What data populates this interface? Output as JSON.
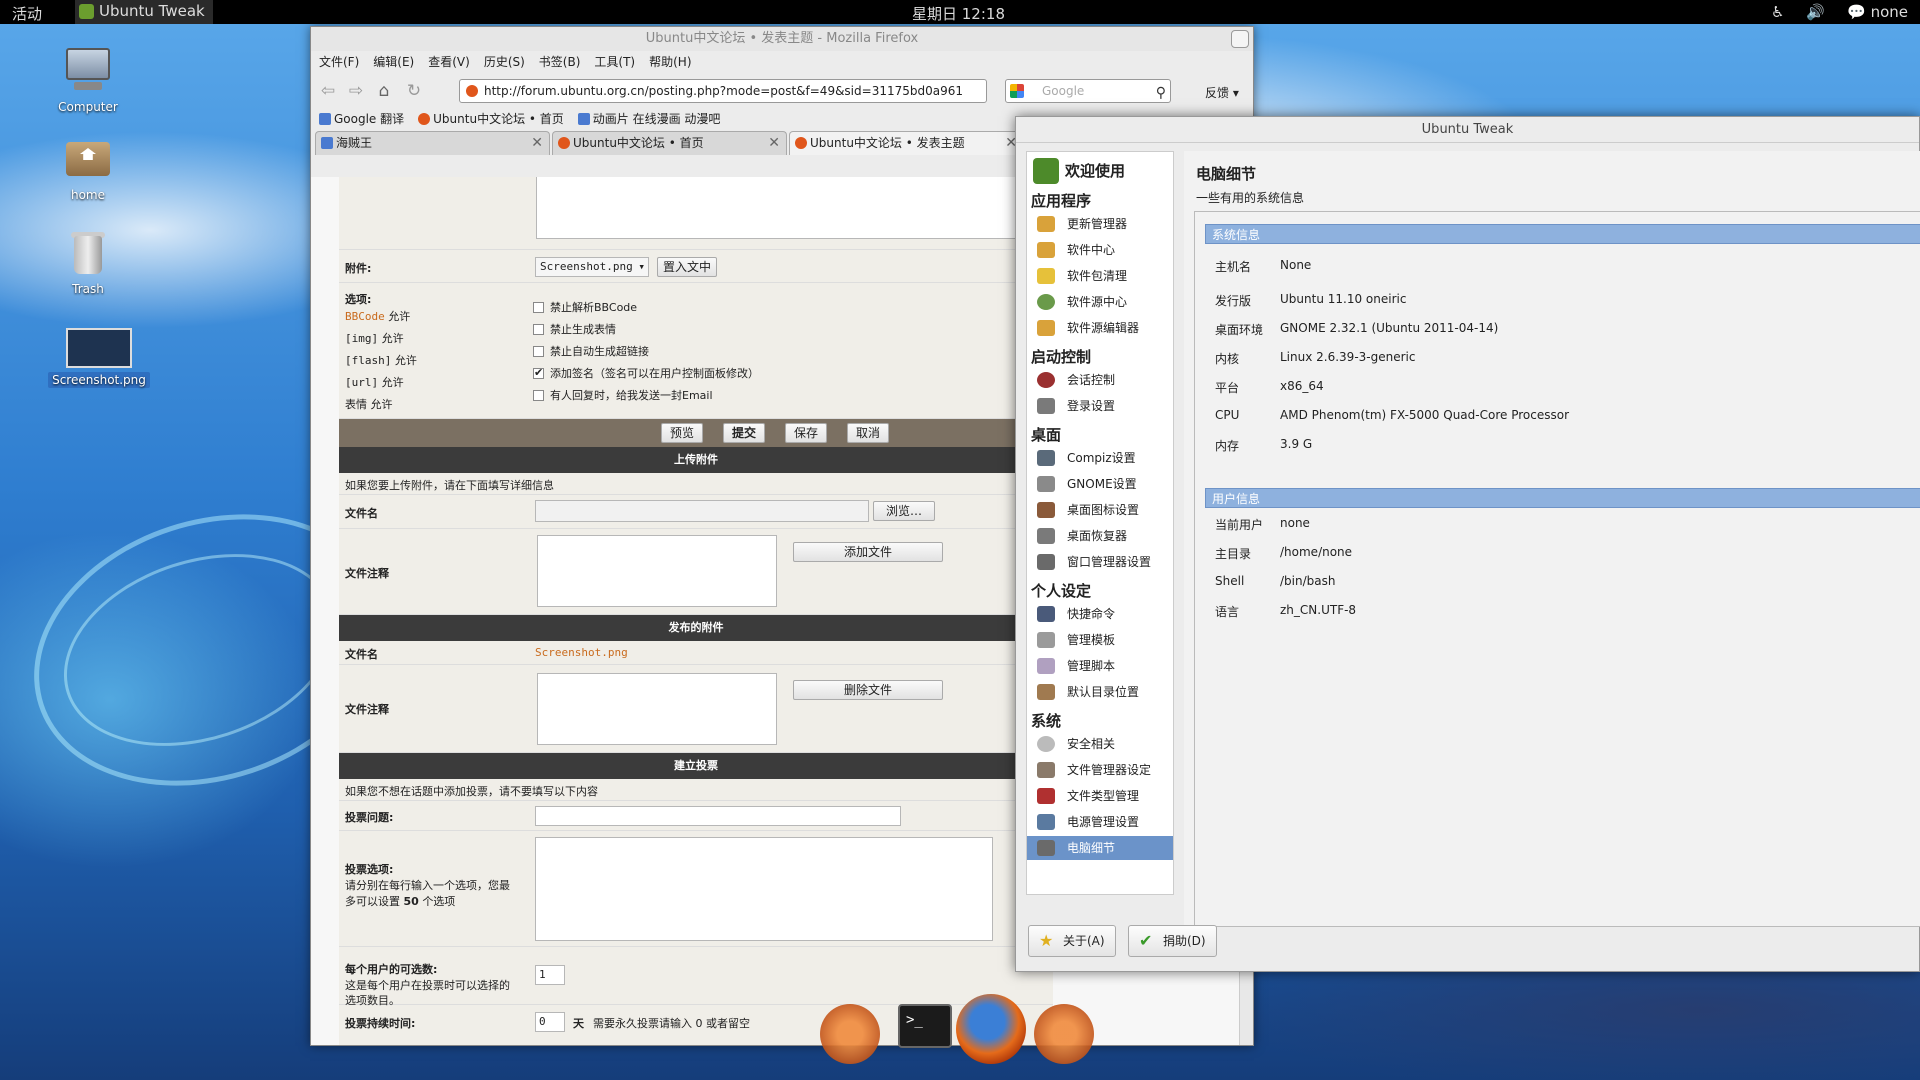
{
  "top_panel": {
    "activities": "活动",
    "app_name": "Ubuntu Tweak",
    "clock": "星期日 12:18",
    "accessibility_icon": "accessibility-icon",
    "volume_icon": "volume-icon",
    "user_label": "none"
  },
  "desktop": {
    "icons": [
      {
        "label": "Computer"
      },
      {
        "label": "home"
      },
      {
        "label": "Trash"
      },
      {
        "label": "Screenshot.png"
      }
    ]
  },
  "firefox": {
    "title": "Ubuntu中文论坛 • 发表主题 - Mozilla Firefox",
    "menu": [
      "文件(F)",
      "编辑(E)",
      "查看(V)",
      "历史(S)",
      "书签(B)",
      "工具(T)",
      "帮助(H)"
    ],
    "url": "http://forum.ubuntu.org.cn/posting.php?mode=post&f=49&sid=31175bd0a961",
    "search_placeholder": "Google",
    "feedback": "反馈",
    "bookmarks": [
      "Google 翻译",
      "Ubuntu中文论坛 • 首页",
      "动画片 在线漫画 动漫吧"
    ],
    "tabs": [
      {
        "label": "海贼王"
      },
      {
        "label": "Ubuntu中文论坛 • 首页"
      },
      {
        "label": "Ubuntu中文论坛 • 发表主题"
      }
    ]
  },
  "form": {
    "attachment_label": "附件:",
    "attachment_select": "Screenshot.png",
    "insert_button": "置入文中",
    "options_label": "选项:",
    "bbcode_rules": [
      {
        "name": "BBCode",
        "state": "允许"
      },
      {
        "name": "[img]",
        "state": "允许"
      },
      {
        "name": "[flash]",
        "state": "允许"
      },
      {
        "name": "[url]",
        "state": "允许"
      },
      {
        "name": "表情",
        "state": "允许"
      }
    ],
    "checkboxes": [
      {
        "label": "禁止解析BBCode",
        "checked": false
      },
      {
        "label": "禁止生成表情",
        "checked": false
      },
      {
        "label": "禁止自动生成超链接",
        "checked": false
      },
      {
        "label": "添加签名（签名可以在用户控制面板修改）",
        "checked": true
      },
      {
        "label": "有人回复时，给我发送一封Email",
        "checked": false
      }
    ],
    "actions": [
      "预览",
      "提交",
      "保存",
      "取消"
    ],
    "upload_header": "上传附件",
    "upload_hint": "如果您要上传附件，请在下面填写详细信息",
    "filename_label": "文件名",
    "browse_button": "浏览…",
    "comment_label": "文件注释",
    "add_file_button": "添加文件",
    "posted_header": "发布的附件",
    "posted_filename_label": "文件名",
    "posted_filename": "Screenshot.png",
    "posted_comment_label": "文件注释",
    "delete_file_button": "删除文件",
    "poll_header": "建立投票",
    "poll_hint": "如果您不想在话题中添加投票，请不要填写以下内容",
    "poll_question_label": "投票问题:",
    "poll_options_label": "投票选项:",
    "poll_options_desc_1": "请分别在每行输入一个选项，您最",
    "poll_options_desc_2": "多可以设置",
    "poll_options_max": "50",
    "poll_options_desc_3": "个选项",
    "per_user_label": "每个用户的可选数:",
    "per_user_desc_1": "这是每个用户在投票时可以选择的",
    "per_user_desc_2": "选项数目。",
    "per_user_value": "1",
    "duration_label": "投票持续时间:",
    "duration_value": "0",
    "duration_unit": "天",
    "duration_hint": "需要永久投票请输入 0 或者留空"
  },
  "tweak": {
    "title": "Ubuntu Tweak",
    "welcome": "欢迎使用",
    "categories": [
      {
        "name": "应用程序",
        "items": [
          "更新管理器",
          "软件中心",
          "软件包清理",
          "软件源中心",
          "软件源编辑器"
        ]
      },
      {
        "name": "启动控制",
        "items": [
          "会话控制",
          "登录设置"
        ]
      },
      {
        "name": "桌面",
        "items": [
          "Compiz设置",
          "GNOME设置",
          "桌面图标设置",
          "桌面恢复器",
          "窗口管理器设置"
        ]
      },
      {
        "name": "个人设定",
        "items": [
          "快捷命令",
          "管理模板",
          "管理脚本",
          "默认目录位置"
        ]
      },
      {
        "name": "系统",
        "items": [
          "安全相关",
          "文件管理器设定",
          "文件类型管理",
          "电源管理设置",
          "电脑细节"
        ]
      }
    ],
    "selected_item": "电脑细节",
    "main_title": "电脑细节",
    "main_subtitle": "一些有用的系统信息",
    "system_section": "系统信息",
    "system_info": [
      {
        "k": "主机名",
        "v": "None"
      },
      {
        "k": "发行版",
        "v": "Ubuntu 11.10 oneiric"
      },
      {
        "k": "桌面环境",
        "v": "GNOME 2.32.1 (Ubuntu 2011-04-14)"
      },
      {
        "k": "内核",
        "v": "Linux 2.6.39-3-generic"
      },
      {
        "k": "平台",
        "v": "x86_64"
      },
      {
        "k": "CPU",
        "v": "AMD Phenom(tm) FX-5000 Quad-Core Processor"
      },
      {
        "k": "内存",
        "v": "3.9 G"
      }
    ],
    "user_section": "用户信息",
    "user_info": [
      {
        "k": "当前用户",
        "v": "none"
      },
      {
        "k": "主目录",
        "v": "/home/none"
      },
      {
        "k": "Shell",
        "v": "/bin/bash"
      },
      {
        "k": "语言",
        "v": "zh_CN.UTF-8"
      }
    ],
    "about_button": "关于(A)",
    "donate_button": "捐助(D)"
  }
}
